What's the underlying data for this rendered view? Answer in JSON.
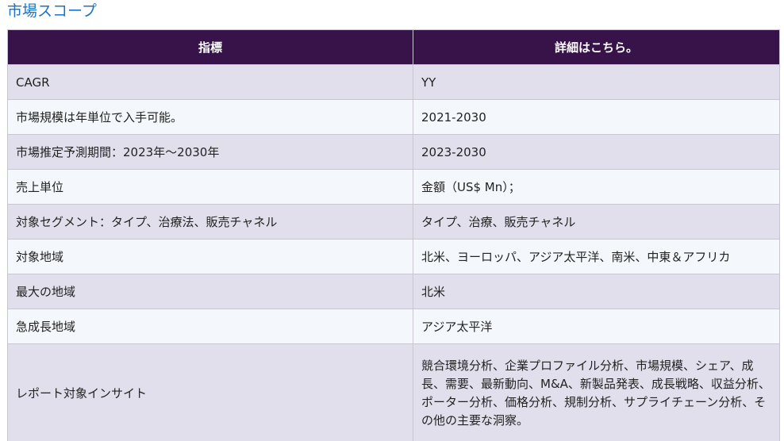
{
  "section_title": "市場スコープ",
  "table": {
    "headers": [
      "指標",
      "詳細はこちら。"
    ],
    "rows": [
      {
        "label": "CAGR",
        "value": "YY"
      },
      {
        "label": "市場規模は年単位で入手可能。",
        "value": "2021-2030"
      },
      {
        "label": "市場推定予測期間：2023年～2030年",
        "value": "2023-2030"
      },
      {
        "label": "売上単位",
        "value": "金額（US$ Mn）；"
      },
      {
        "label": "対象セグメント：タイプ、治療法、販売チャネル",
        "value": "タイプ、治療、販売チャネル"
      },
      {
        "label": "対象地域",
        "value": "北米、ヨーロッパ、アジア太平洋、南米、中東＆アフリカ"
      },
      {
        "label": "最大の地域",
        "value": "北米"
      },
      {
        "label": "急成長地域",
        "value": "アジア太平洋"
      },
      {
        "label": "レポート対象インサイト",
        "value": "競合環境分析、企業プロファイル分析、市場規模、シェア、成長、需要、最新動向、M&A、新製品発表、成長戦略、収益分析、ポーター分析、価格分析、規制分析、サプライチェーン分析、その他の主要な洞察。"
      }
    ]
  }
}
